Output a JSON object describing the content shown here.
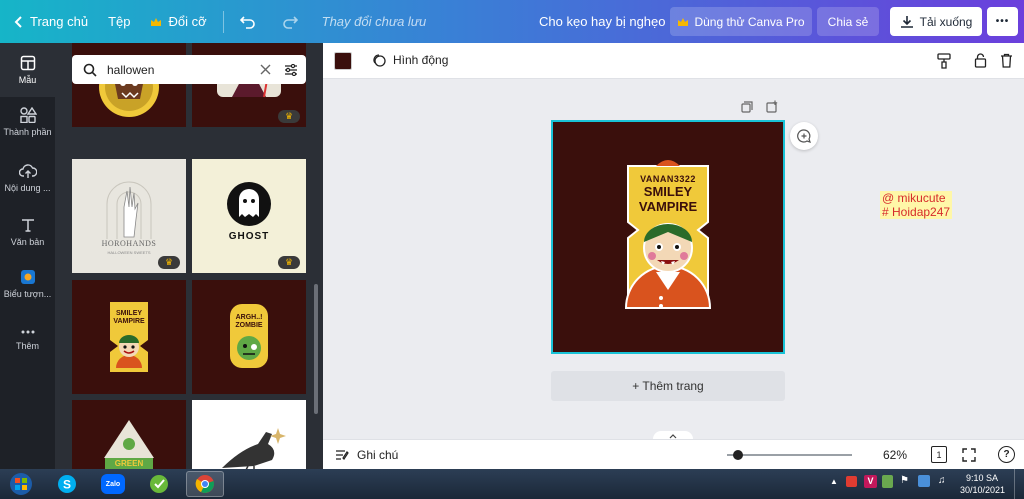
{
  "topbar": {
    "home": "Trang chủ",
    "file": "Tệp",
    "resize": "Đổi cỡ",
    "unsaved": "Thay đổi chưa lưu",
    "title": "Cho kẹo hay bị nghẹo",
    "pro": "Dùng thử Canva Pro",
    "share": "Chia sẻ",
    "download": "Tải xuống",
    "more": "•••"
  },
  "rail": [
    {
      "label": "Mẫu"
    },
    {
      "label": "Thành phần"
    },
    {
      "label": "Nội dung ..."
    },
    {
      "label": "Văn bản"
    },
    {
      "label": "Biểu tượn..."
    },
    {
      "label": "Thêm"
    }
  ],
  "search": {
    "value": "hallowen"
  },
  "thumbs": {
    "horohands_title": "HOROHANDS",
    "horohands_sub": "HALLOWEEN SWEETS",
    "ghost": "GHOST",
    "smiley_top": "SMILEY",
    "smiley_bottom": "VAMPIRE",
    "zombie_top": "ARGH..!",
    "zombie_bottom": "ZOMBIE",
    "green": "GREEN"
  },
  "editor": {
    "animate": "Hình động"
  },
  "page": {
    "brand": "VANAN3322",
    "line1": "SMILEY",
    "line2": "VAMPIRE"
  },
  "canvas": {
    "add_page": "+ Thêm trang"
  },
  "watermark": {
    "line1": "@ mikucute",
    "line2": "# Hoidap247"
  },
  "footer": {
    "notes": "Ghi chú",
    "zoom": "62%",
    "page_num": "1",
    "zoom_fraction": 0.05
  },
  "taskbar": {
    "time": "9:10 SA",
    "date": "30/10/2021",
    "zalo": "Zalo",
    "lang": "V"
  },
  "colors": {
    "page_bg": "#3a0f0c",
    "accent": "#19c2d6",
    "rail_bg": "#1e2127",
    "panel_bg": "#2b2f36"
  }
}
